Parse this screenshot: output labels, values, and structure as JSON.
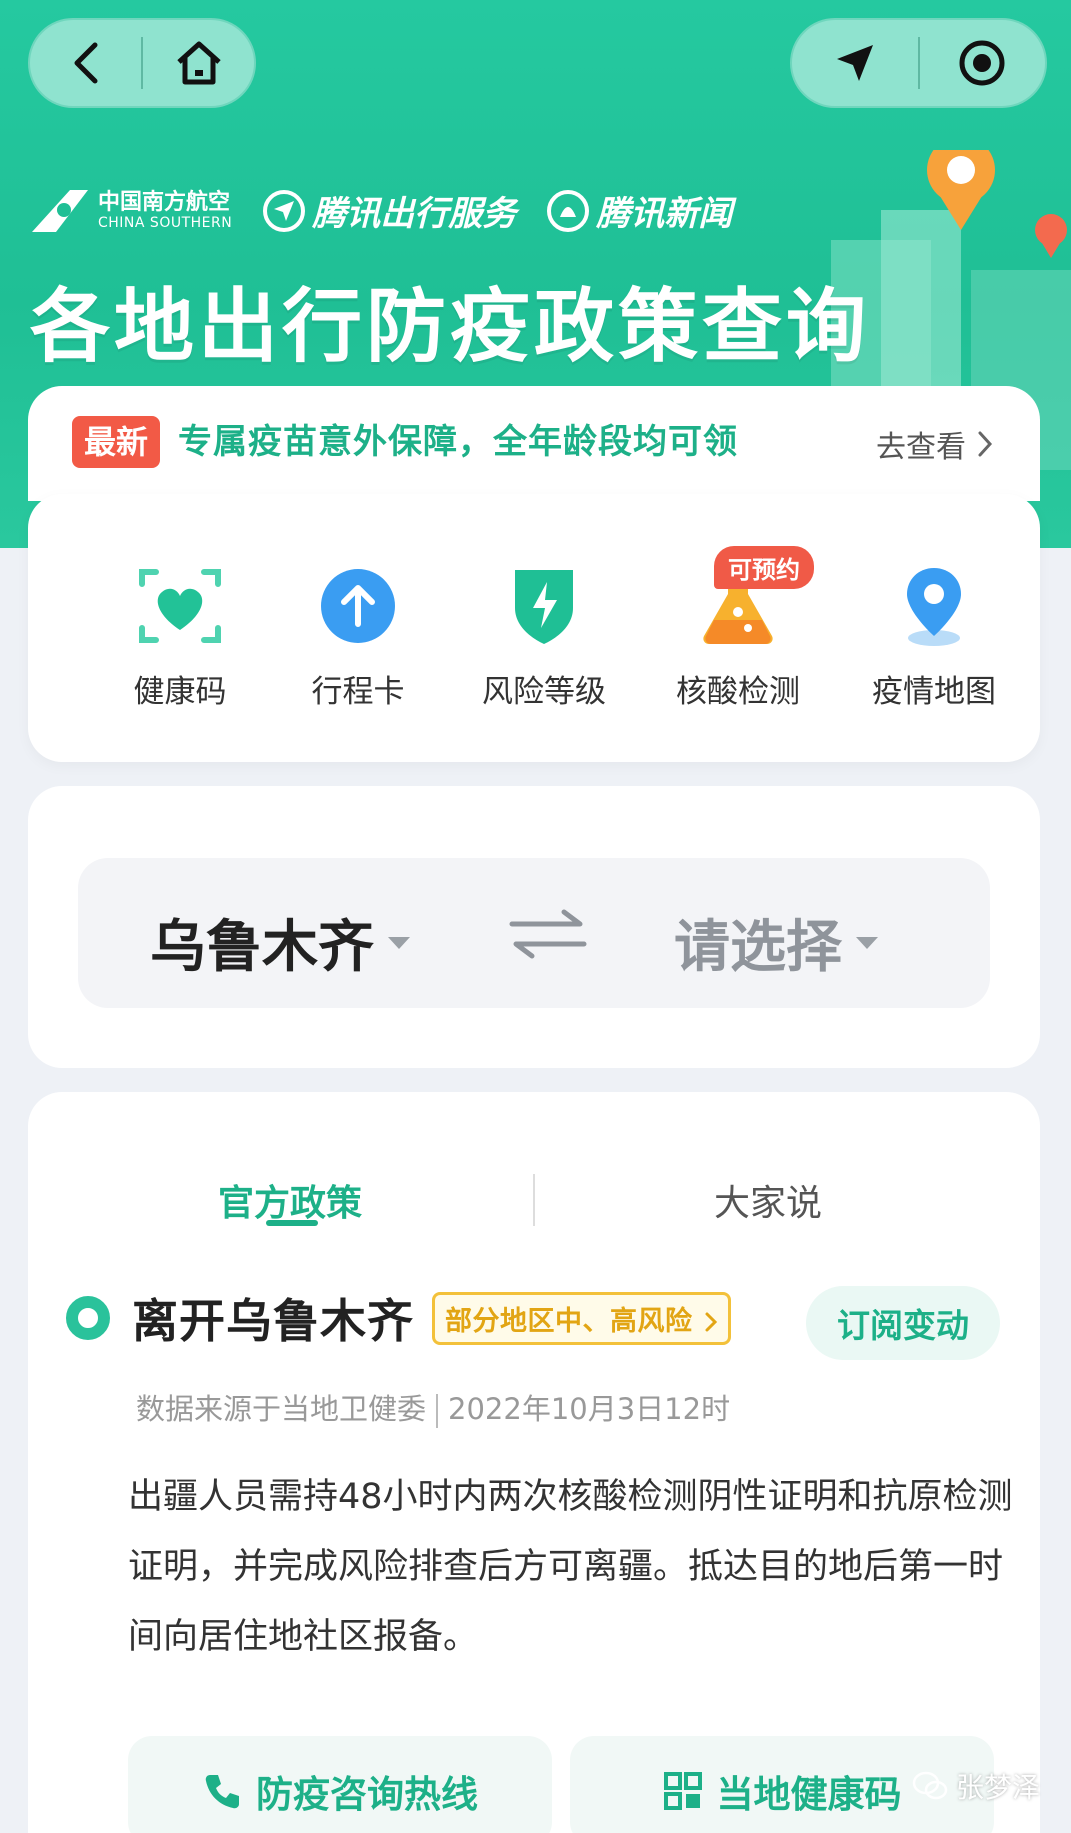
{
  "hero": {
    "brands": {
      "china_southern_cn": "中国南方航空",
      "china_southern_en": "CHINA SOUTHERN",
      "tencent_travel": "腾讯出行服务",
      "tencent_news": "腾讯新闻"
    },
    "title": "各地出行防疫政策查询"
  },
  "notice": {
    "badge": "最新",
    "text": "专属疫苗意外保障，全年龄段均可领",
    "link": "去查看"
  },
  "services": {
    "items": [
      {
        "label": "健康码",
        "icon": "heart-scan-icon"
      },
      {
        "label": "行程卡",
        "icon": "arrow-up-icon"
      },
      {
        "label": "风险等级",
        "icon": "shield-bolt-icon"
      },
      {
        "label": "核酸检测",
        "icon": "flask-icon"
      },
      {
        "label": "疫情地图",
        "icon": "map-pin-icon"
      }
    ],
    "appointment_tag": "可预约"
  },
  "cities": {
    "from": "乌鲁木齐",
    "to": "请选择"
  },
  "policy": {
    "tabs": [
      "官方政策",
      "大家说"
    ],
    "leave_title": "离开乌鲁木齐",
    "risk_tag": "部分地区中、高风险",
    "subscribe": "订阅变动",
    "source": "数据来源于当地卫健委",
    "timestamp": "2022年10月3日12时",
    "body": "出疆人员需持48小时内两次核酸检测阴性证明和抗原检测证明，并完成风险排查后方可离疆。抵达目的地后第一时间向居住地社区报备。",
    "buttons": [
      "防疫咨询热线",
      "当地健康码"
    ]
  },
  "watermark": "张梦泽",
  "colors": {
    "brand_green": "#1db088",
    "hero_green": "#25c9a0",
    "alert_red": "#f25a46",
    "warning_yellow": "#f3c13a"
  }
}
